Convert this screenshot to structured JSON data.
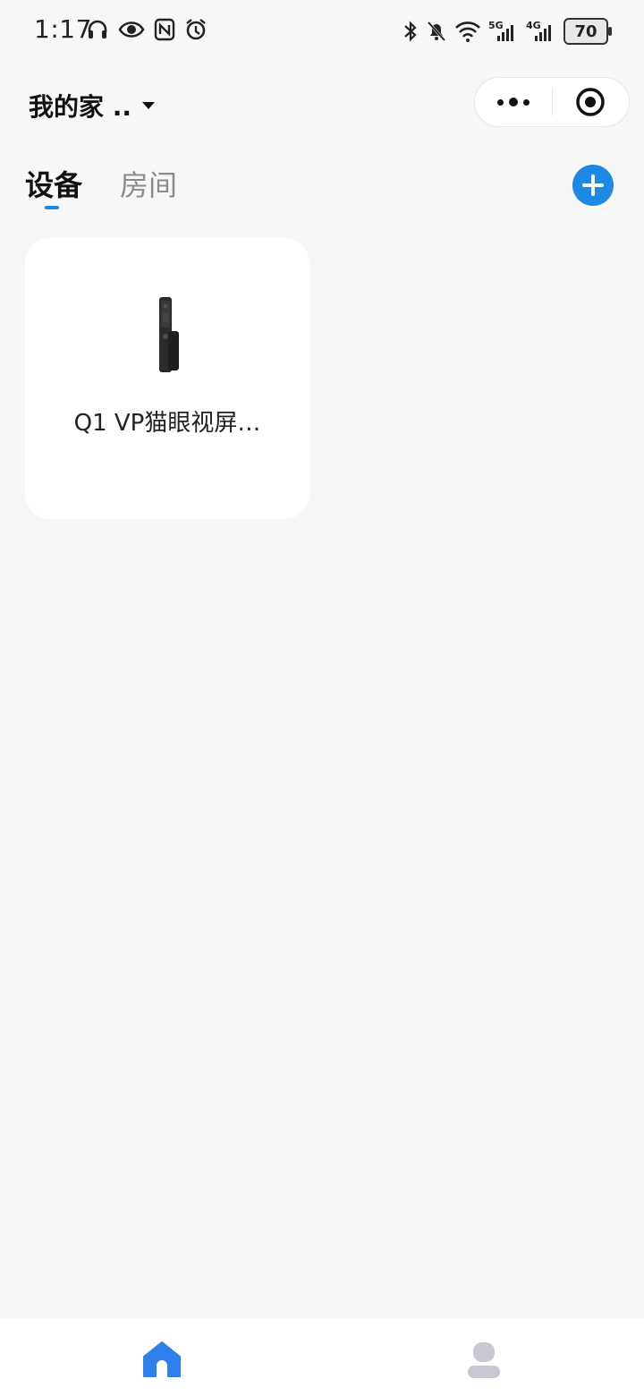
{
  "status_bar": {
    "time": "1:17",
    "left_icons": [
      "headphones-icon",
      "eye-icon",
      "nfc-icon",
      "alarm-icon"
    ],
    "right_icons": [
      "bluetooth-icon",
      "notifications-off-icon",
      "wifi-icon",
      "5g-signal-icon",
      "4g-signal-icon"
    ],
    "network_5g": "5G",
    "network_4g": "4G",
    "battery": "70"
  },
  "header": {
    "home_name": "我的家 ..",
    "capsule": {
      "more_icon": "more-dots-icon",
      "close_icon": "target-icon"
    }
  },
  "tabs": [
    {
      "label": "设备",
      "active": true
    },
    {
      "label": "房间",
      "active": false
    }
  ],
  "add_button": {
    "icon": "plus-icon",
    "color": "#1e88e5"
  },
  "devices": [
    {
      "name": "Q1 VP猫眼视屏…",
      "image": "smart-door-lock"
    }
  ],
  "bottom_nav": [
    {
      "icon": "home-icon",
      "active": true,
      "color": "#2f80ed"
    },
    {
      "icon": "profile-icon",
      "active": false,
      "color": "#c8c8d2"
    }
  ]
}
